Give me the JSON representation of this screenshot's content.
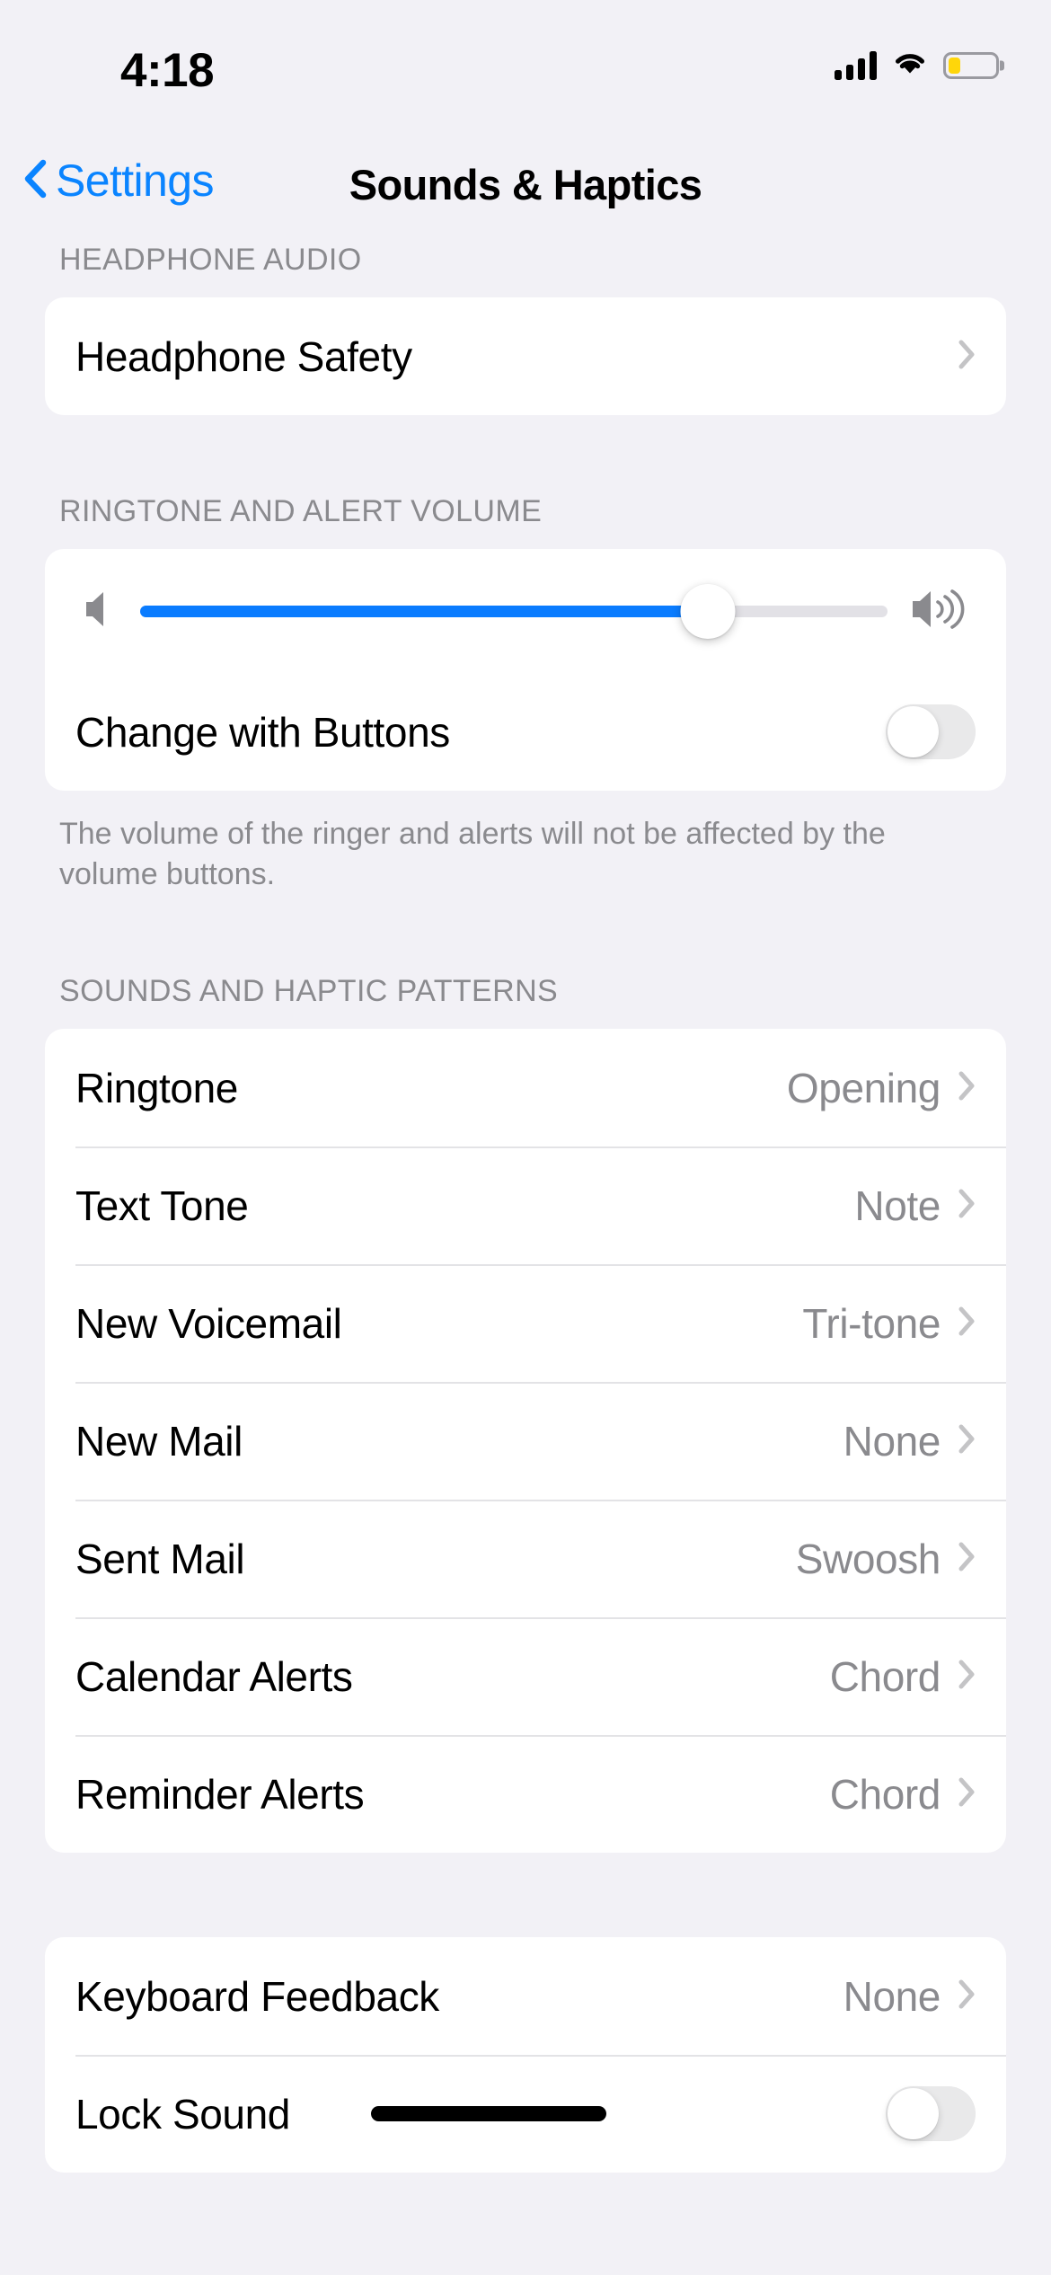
{
  "status_bar": {
    "time": "4:18",
    "cellular_icon": "cellular-signal-icon",
    "cellular_bars": 4,
    "wifi_icon": "wifi-icon",
    "battery_icon": "battery-icon",
    "battery_level_percent": 25,
    "battery_color": "#FFD60A"
  },
  "nav": {
    "back_label": "Settings",
    "back_icon": "chevron-left-icon",
    "title": "Sounds & Haptics",
    "accent_color": "#0A84FF"
  },
  "sections": [
    {
      "header": "HEADPHONE AUDIO",
      "rows": [
        {
          "label": "Headphone Safety",
          "value": "",
          "type": "disclosure"
        }
      ]
    },
    {
      "header": "RINGTONE AND ALERT VOLUME",
      "footer": "The volume of the ringer and alerts will not be affected by the volume buttons.",
      "slider": {
        "value_percent": 76,
        "low_icon": "speaker-low-icon",
        "high_icon": "speaker-high-icon",
        "fill_color": "#0A7CFF",
        "track_color": "#E2E1E6"
      },
      "rows": [
        {
          "label": "Change with Buttons",
          "type": "toggle",
          "enabled": false
        }
      ]
    },
    {
      "header": "SOUNDS AND HAPTIC PATTERNS",
      "rows": [
        {
          "label": "Ringtone",
          "value": "Opening",
          "type": "disclosure"
        },
        {
          "label": "Text Tone",
          "value": "Note",
          "type": "disclosure"
        },
        {
          "label": "New Voicemail",
          "value": "Tri-tone",
          "type": "disclosure"
        },
        {
          "label": "New Mail",
          "value": "None",
          "type": "disclosure"
        },
        {
          "label": "Sent Mail",
          "value": "Swoosh",
          "type": "disclosure"
        },
        {
          "label": "Calendar Alerts",
          "value": "Chord",
          "type": "disclosure"
        },
        {
          "label": "Reminder Alerts",
          "value": "Chord",
          "type": "disclosure"
        }
      ]
    },
    {
      "header": "",
      "rows": [
        {
          "label": "Keyboard Feedback",
          "value": "None",
          "type": "disclosure"
        },
        {
          "label": "Lock Sound",
          "type": "toggle",
          "enabled": false,
          "annotation": "black-stroke-mark"
        }
      ]
    }
  ],
  "colors": {
    "page_background": "#F2F1F6",
    "card_background": "#FFFFFF",
    "secondary_text": "#8A8A8E",
    "separator": "#E3E3E6",
    "toggle_off_track": "#E9E9EA"
  }
}
